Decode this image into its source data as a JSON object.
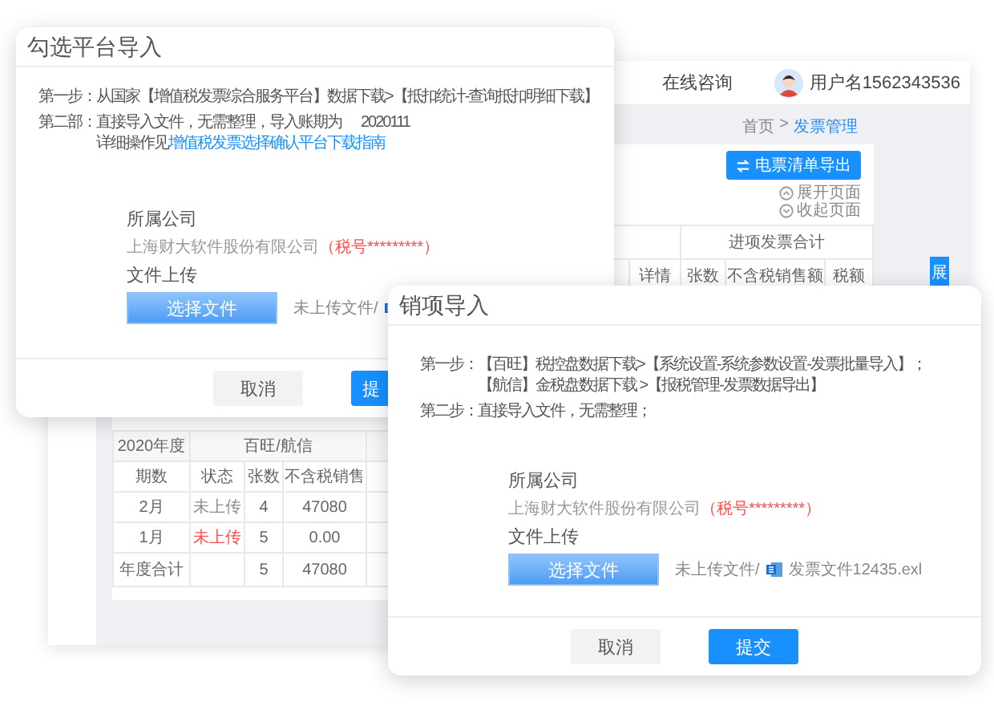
{
  "background_app": {
    "header": {
      "consult_link": "在线咨询",
      "username": "用户名1562343536"
    },
    "breadcrumb": {
      "home": "首页",
      "separator": ">",
      "current": "发票管理"
    },
    "export_button": "电票清单导出",
    "expand_link": "展开页面",
    "collapse_link": "收起页面",
    "input_table": {
      "group_header": "进项发票合计",
      "columns": [
        "详情",
        "张数",
        "不含税销售额",
        "税额"
      ]
    },
    "annual_table": {
      "year": "2020年度",
      "group_header": "百旺/航信",
      "columns": [
        "期数",
        "状态",
        "张数",
        "不含税销售"
      ],
      "rows": [
        {
          "period": "2月",
          "status": {
            "text": "未上传",
            "color": "#8c8c8c"
          },
          "count": "4",
          "amount": "47080"
        },
        {
          "period": "1月",
          "status": {
            "text": "未上传",
            "color": "#ff4d4f"
          },
          "count": "5",
          "amount": "0.00"
        }
      ],
      "total": {
        "label": "年度合计",
        "count": "5",
        "amount": "47080"
      }
    },
    "side_tab": "展"
  },
  "checkbox_import_dialog": {
    "title": "勾选平台导入",
    "steps": [
      {
        "label": "第一步：",
        "lines": [
          "从国家【增值税发票综合服务平台】数据下载>【抵扣统计-查询抵扣明细下载】"
        ]
      },
      {
        "label": "第二部：",
        "lines": [
          "直接导入文件，无需整理，导入账期为"
        ],
        "value": "2020111"
      }
    ],
    "guide": {
      "prefix": "详细操作见",
      "link": "增值税发票选择确认平台下载指南"
    },
    "company_label": "所属公司",
    "company_name": "上海财大软件股份有限公司",
    "tax_id": "（税号*********）",
    "upload_label": "文件上传",
    "choose_button": "选择文件",
    "upload_status": "未上传文件/",
    "buttons": [
      {
        "label": "取消",
        "kind": "secondary"
      },
      {
        "label": "提",
        "kind": "primary"
      }
    ]
  },
  "sales_import_dialog": {
    "title": "销项导入",
    "steps": [
      {
        "label": "第一步：",
        "lines": [
          "【百旺】税控盘数据下载>【系统设置-系统参数设置-发票批量导入】；",
          "【航信】金税盘数据下载 >【报税管理-发票数据导出】"
        ]
      },
      {
        "label": "第二步：",
        "lines": [
          "直接导入文件，无需整理；"
        ]
      }
    ],
    "company_label": "所属公司",
    "company_name": "上海财大软件股份有限公司",
    "tax_id": "（税号*********）",
    "upload_label": "文件上传",
    "choose_button": "选择文件",
    "upload_status": "未上传文件/",
    "file_name": "发票文件12435.exl",
    "buttons": [
      {
        "label": "取消",
        "kind": "secondary"
      },
      {
        "label": "提交",
        "kind": "primary"
      }
    ]
  }
}
